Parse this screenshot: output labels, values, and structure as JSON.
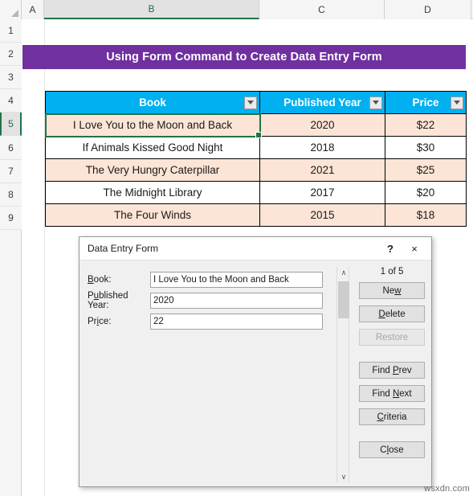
{
  "spreadsheet": {
    "column_headers": [
      "A",
      "B",
      "C",
      "D"
    ],
    "selected_column": "B",
    "row_headers": [
      "1",
      "2",
      "3",
      "4",
      "5",
      "6",
      "7",
      "8",
      "9"
    ],
    "selected_row": "5",
    "banner_title": "Using Form Command to Create Data Entry Form",
    "banner_color": "#7030a0",
    "header_color": "#00b0f0",
    "stripe_color": "#fce4d6",
    "selection_color": "#217346",
    "table": {
      "headers": [
        "Book",
        "Published Year",
        "Price"
      ],
      "rows": [
        [
          "I Love You to the Moon and Back",
          "2020",
          "$22"
        ],
        [
          "If Animals Kissed Good Night",
          "2018",
          "$30"
        ],
        [
          "The Very Hungry Caterpillar",
          "2021",
          "$25"
        ],
        [
          "The Midnight Library",
          "2017",
          "$20"
        ],
        [
          "The Four Winds",
          "2015",
          "$18"
        ]
      ]
    }
  },
  "dialog": {
    "title": "Data Entry Form",
    "help_label": "?",
    "close_label": "×",
    "record_counter": "1 of 5",
    "fields": [
      {
        "label": "Book:",
        "value": "I Love You to the Moon and Back"
      },
      {
        "label": "Published Year:",
        "value": "2020"
      },
      {
        "label": "Price:",
        "value": "22"
      }
    ],
    "buttons": [
      {
        "label": "New",
        "disabled": false
      },
      {
        "label": "Delete",
        "disabled": false
      },
      {
        "label": "Restore",
        "disabled": true
      },
      {
        "label": "Find Prev",
        "disabled": false
      },
      {
        "label": "Find Next",
        "disabled": false
      },
      {
        "label": "Criteria",
        "disabled": false
      },
      {
        "label": "Close",
        "disabled": false
      }
    ],
    "scroll_up_glyph": "∧",
    "scroll_down_glyph": "∨"
  },
  "watermark": "wsxdn.com"
}
